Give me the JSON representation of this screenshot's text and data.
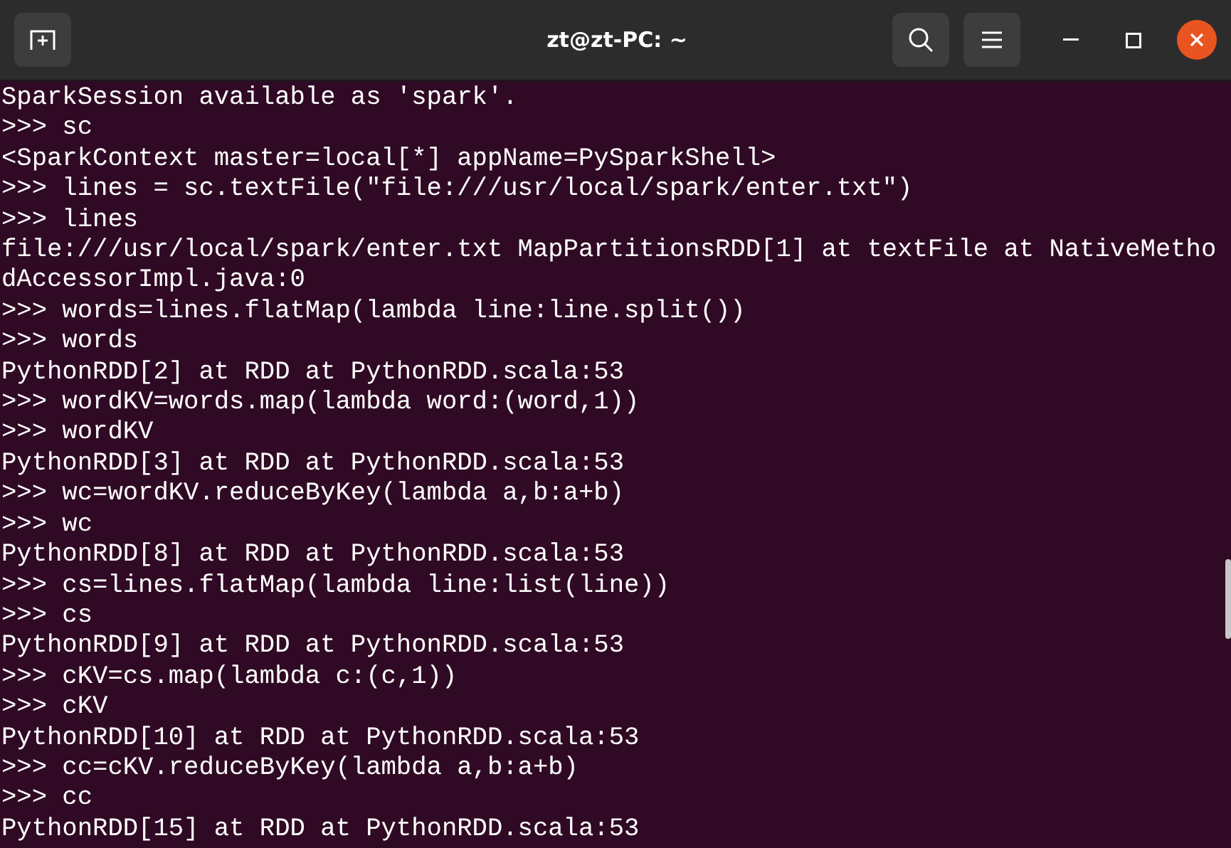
{
  "window": {
    "title": "zt@zt-PC: ~"
  },
  "terminal": {
    "lines": [
      "SparkSession available as 'spark'.",
      ">>> sc",
      "<SparkContext master=local[*] appName=PySparkShell>",
      ">>> lines = sc.textFile(\"file:///usr/local/spark/enter.txt\")",
      ">>> lines",
      "file:///usr/local/spark/enter.txt MapPartitionsRDD[1] at textFile at NativeMetho",
      "dAccessorImpl.java:0",
      ">>> words=lines.flatMap(lambda line:line.split())",
      ">>> words",
      "PythonRDD[2] at RDD at PythonRDD.scala:53",
      ">>> wordKV=words.map(lambda word:(word,1))",
      ">>> wordKV",
      "PythonRDD[3] at RDD at PythonRDD.scala:53",
      ">>> wc=wordKV.reduceByKey(lambda a,b:a+b)",
      ">>> wc",
      "PythonRDD[8] at RDD at PythonRDD.scala:53",
      ">>> cs=lines.flatMap(lambda line:list(line))",
      ">>> cs",
      "PythonRDD[9] at RDD at PythonRDD.scala:53",
      ">>> cKV=cs.map(lambda c:(c,1))",
      ">>> cKV",
      "PythonRDD[10] at RDD at PythonRDD.scala:53",
      ">>> cc=cKV.reduceByKey(lambda a,b:a+b)",
      ">>> cc",
      "PythonRDD[15] at RDD at PythonRDD.scala:53"
    ]
  }
}
